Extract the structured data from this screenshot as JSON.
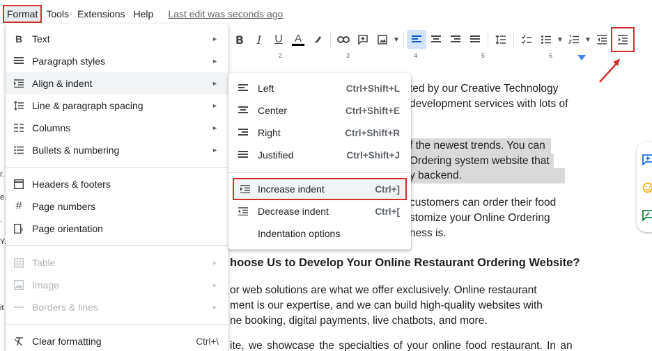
{
  "menubar": {
    "items": [
      "Format",
      "Tools",
      "Extensions",
      "Help"
    ],
    "last_edit": "Last edit was seconds ago"
  },
  "toolbar": {
    "icons": [
      "bold-icon",
      "italic-icon",
      "underline-icon",
      "text-color-icon",
      "highlight-icon",
      "link-icon",
      "comment-icon",
      "image-icon",
      "align-left-icon",
      "align-center-icon",
      "align-right-icon",
      "justify-icon",
      "line-spacing-icon",
      "checklist-icon",
      "bullet-list-icon",
      "numbered-list-icon",
      "decrease-indent-icon",
      "increase-indent-icon"
    ],
    "bold": "B",
    "italic": "I",
    "underline": "U",
    "text_color": "A"
  },
  "ruler": {
    "numbers": [
      "2",
      "3",
      "4",
      "5",
      "6"
    ]
  },
  "format_menu": {
    "items": [
      {
        "label": "Text",
        "icon": "bold-icon",
        "submenu": true
      },
      {
        "label": "Paragraph styles",
        "icon": "paragraph-styles-icon",
        "submenu": true
      },
      {
        "label": "Align & indent",
        "icon": "align-indent-icon",
        "submenu": true
      },
      {
        "label": "Line & paragraph spacing",
        "icon": "line-spacing-icon",
        "submenu": true
      },
      {
        "label": "Columns",
        "icon": "columns-icon",
        "submenu": true
      },
      {
        "label": "Bullets & numbering",
        "icon": "bullets-icon",
        "submenu": true
      },
      {
        "label": "Headers & footers",
        "icon": "header-footer-icon"
      },
      {
        "label": "Page numbers",
        "icon": "hash-icon"
      },
      {
        "label": "Page orientation",
        "icon": "page-orientation-icon"
      },
      {
        "label": "Table",
        "icon": "table-icon",
        "submenu": true,
        "disabled": true
      },
      {
        "label": "Image",
        "icon": "image-icon",
        "submenu": true,
        "disabled": true
      },
      {
        "label": "Borders & lines",
        "icon": "borders-icon",
        "submenu": true,
        "disabled": true
      },
      {
        "label": "Clear formatting",
        "icon": "clear-formatting-icon",
        "shortcut": "Ctrl+\\"
      }
    ]
  },
  "align_submenu": {
    "items": [
      {
        "label": "Left",
        "shortcut": "Ctrl+Shift+L",
        "icon": "align-left-icon"
      },
      {
        "label": "Center",
        "shortcut": "Ctrl+Shift+E",
        "icon": "align-center-icon"
      },
      {
        "label": "Right",
        "shortcut": "Ctrl+Shift+R",
        "icon": "align-right-icon"
      },
      {
        "label": "Justified",
        "shortcut": "Ctrl+Shift+J",
        "icon": "justify-icon"
      },
      {
        "label": "Increase indent",
        "shortcut": "Ctrl+]",
        "icon": "increase-indent-icon"
      },
      {
        "label": "Decrease indent",
        "shortcut": "Ctrl+[",
        "icon": "decrease-indent-icon"
      },
      {
        "label": "Indentation options",
        "shortcut": "",
        "icon": ""
      }
    ]
  },
  "document": {
    "lines": [
      "ted by our Creative Technology",
      "development services with lots of",
      "f the newest trends. You can",
      "Ordering system website that",
      "y backend.",
      "customers can order their food",
      "stomize your Online Ordering",
      "ness is.",
      "hoose Us to Develop Your Online Restaurant Ordering Website?",
      "or web solutions are what we offer exclusively. Online restaurant",
      "ment is our expertise, and we can build high-quality websites with",
      "ne booking, digital payments, live chatbots, and more.",
      "ite, we showcase the specialties of your online food restaurant. In an"
    ]
  },
  "left_fragments": [
    "r.",
    "e.",
    ".",
    "Y.",
    "it"
  ],
  "colors": {
    "accent": "#1a73e8",
    "annotation": "#d32f2f",
    "selection": "#d9d9d9"
  }
}
